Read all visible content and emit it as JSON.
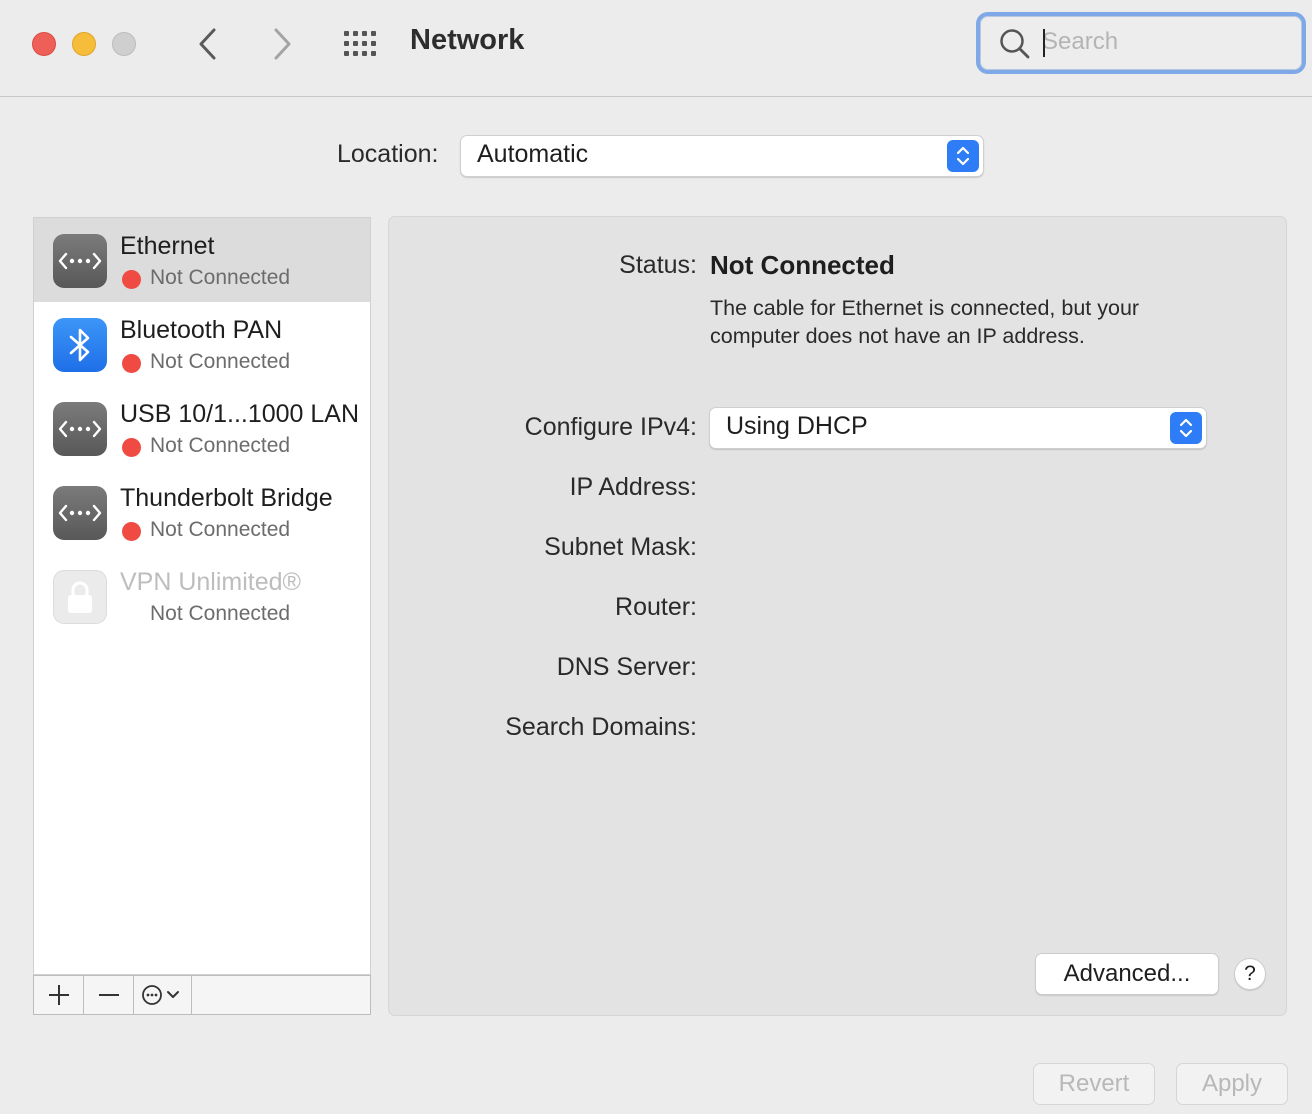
{
  "window": {
    "title": "Network",
    "controls": [
      "close-icon",
      "minimize-icon",
      "zoom-icon"
    ],
    "nav": [
      "back-icon",
      "forward-icon",
      "show-all-grid-icon"
    ]
  },
  "search": {
    "placeholder": "Search",
    "value": ""
  },
  "location": {
    "label": "Location:",
    "value": "Automatic"
  },
  "services": [
    {
      "name": "Ethernet",
      "status": "Not Connected",
      "icon": "ethernet-icon",
      "selected": true,
      "dot_color": "#ef4b43"
    },
    {
      "name": "Bluetooth PAN",
      "status": "Not Connected",
      "icon": "bluetooth-icon",
      "selected": false,
      "dot_color": "#ef4b43"
    },
    {
      "name": "USB 10/1...1000 LAN",
      "status": "Not Connected",
      "icon": "ethernet-icon",
      "selected": false,
      "dot_color": "#ef4b43"
    },
    {
      "name": "Thunderbolt Bridge",
      "status": "Not Connected",
      "icon": "ethernet-icon",
      "selected": false,
      "dot_color": "#ef4b43"
    },
    {
      "name": "VPN Unlimited®",
      "status": "Not Connected",
      "icon": "lock-icon",
      "selected": false,
      "disabled": true
    }
  ],
  "sidebar_toolbar": {
    "add": "+",
    "remove": "—",
    "action": "more-options-icon"
  },
  "detail": {
    "status_label": "Status:",
    "status_value": "Not Connected",
    "status_description": "The cable for Ethernet is connected, but your computer does not have an IP address.",
    "configure_label": "Configure IPv4:",
    "configure_value": "Using DHCP",
    "ip_label": "IP Address:",
    "subnet_label": "Subnet Mask:",
    "router_label": "Router:",
    "dns_label": "DNS Server:",
    "search_domains_label": "Search Domains:",
    "advanced_label": "Advanced...",
    "help_label": "?"
  },
  "footer": {
    "revert": "Revert",
    "apply": "Apply"
  },
  "colors": {
    "accent": "#2e7cf6",
    "status_red": "#ef4b43",
    "focus_ring": "#7fa8e6"
  }
}
